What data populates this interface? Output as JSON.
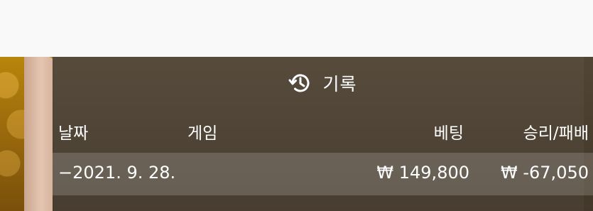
{
  "panel": {
    "title": "기록",
    "icon": "history-icon"
  },
  "table": {
    "headers": {
      "date": "날짜",
      "game": "게임",
      "bet": "베팅",
      "result": "승리/패배"
    },
    "rows": [
      {
        "date": "−2021. 9. 28.",
        "game": "",
        "bet": "₩ 149,800",
        "result": "₩ -67,050"
      }
    ]
  }
}
